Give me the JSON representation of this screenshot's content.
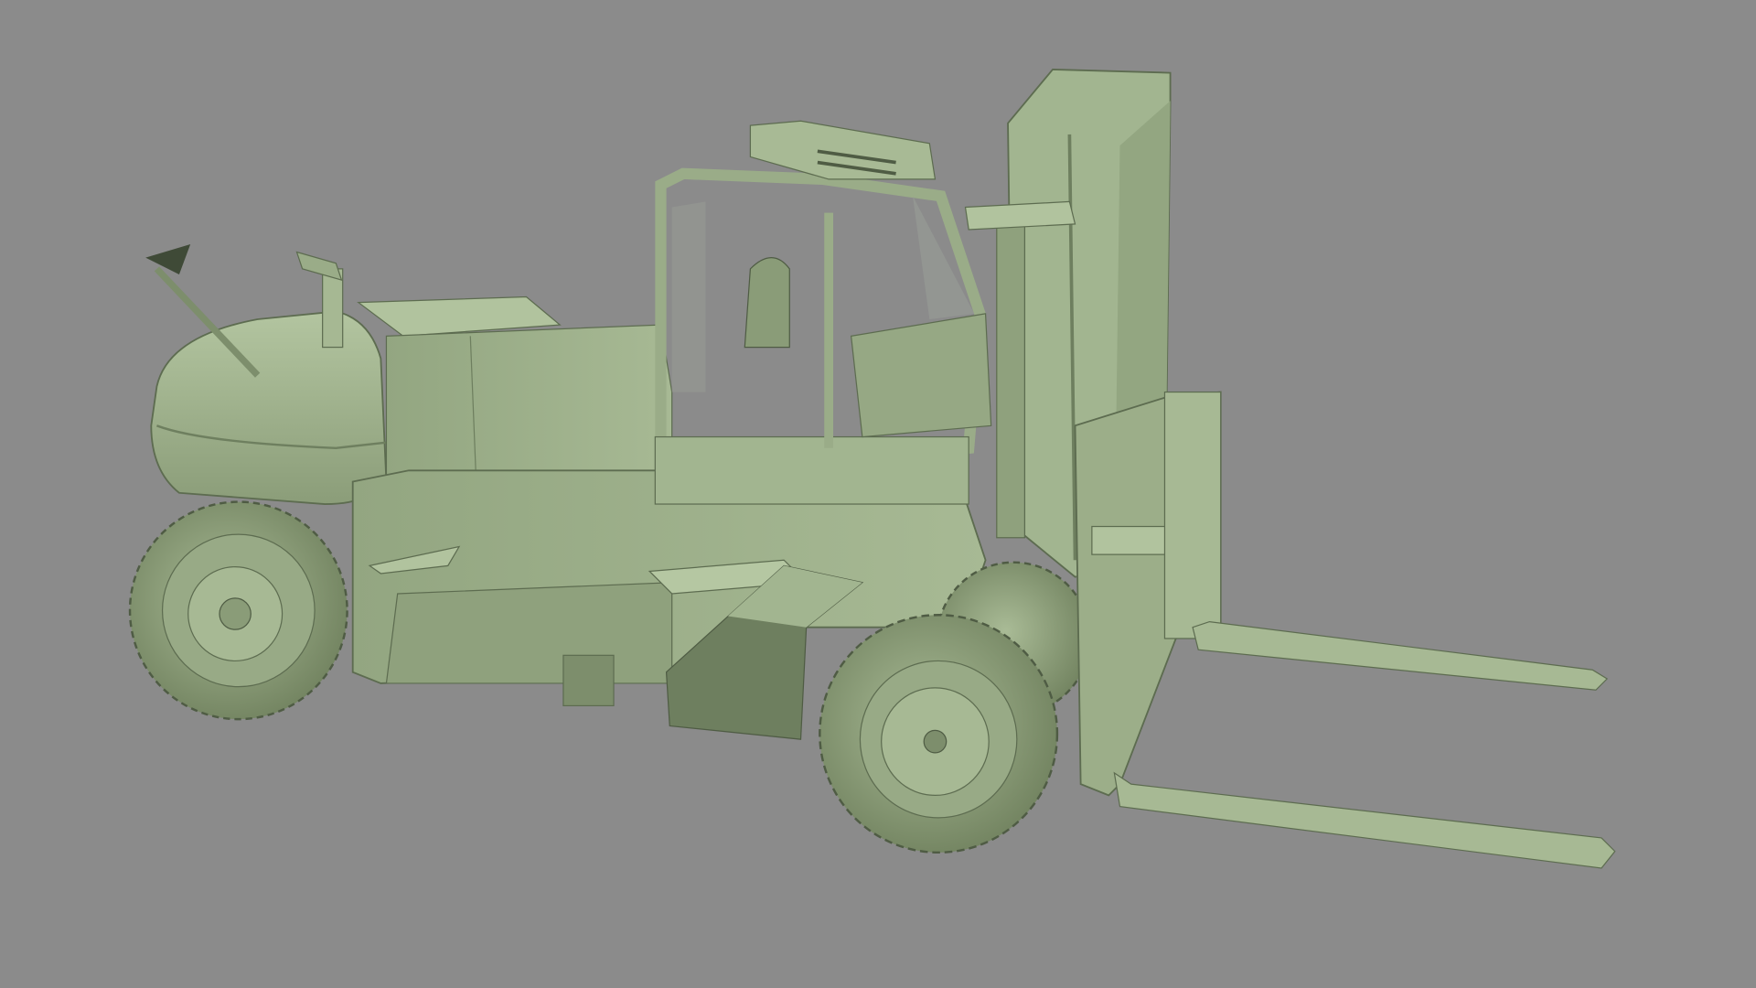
{
  "scene": {
    "subject": "forklift-3d-model",
    "colors": {
      "background": "#8b8b8b",
      "body": "#a2b590",
      "body_light": "#b7c8a4",
      "body_shadow": "#6e7f5f",
      "body_dark": "#4f5c44",
      "glass": "#9a9c98"
    }
  }
}
